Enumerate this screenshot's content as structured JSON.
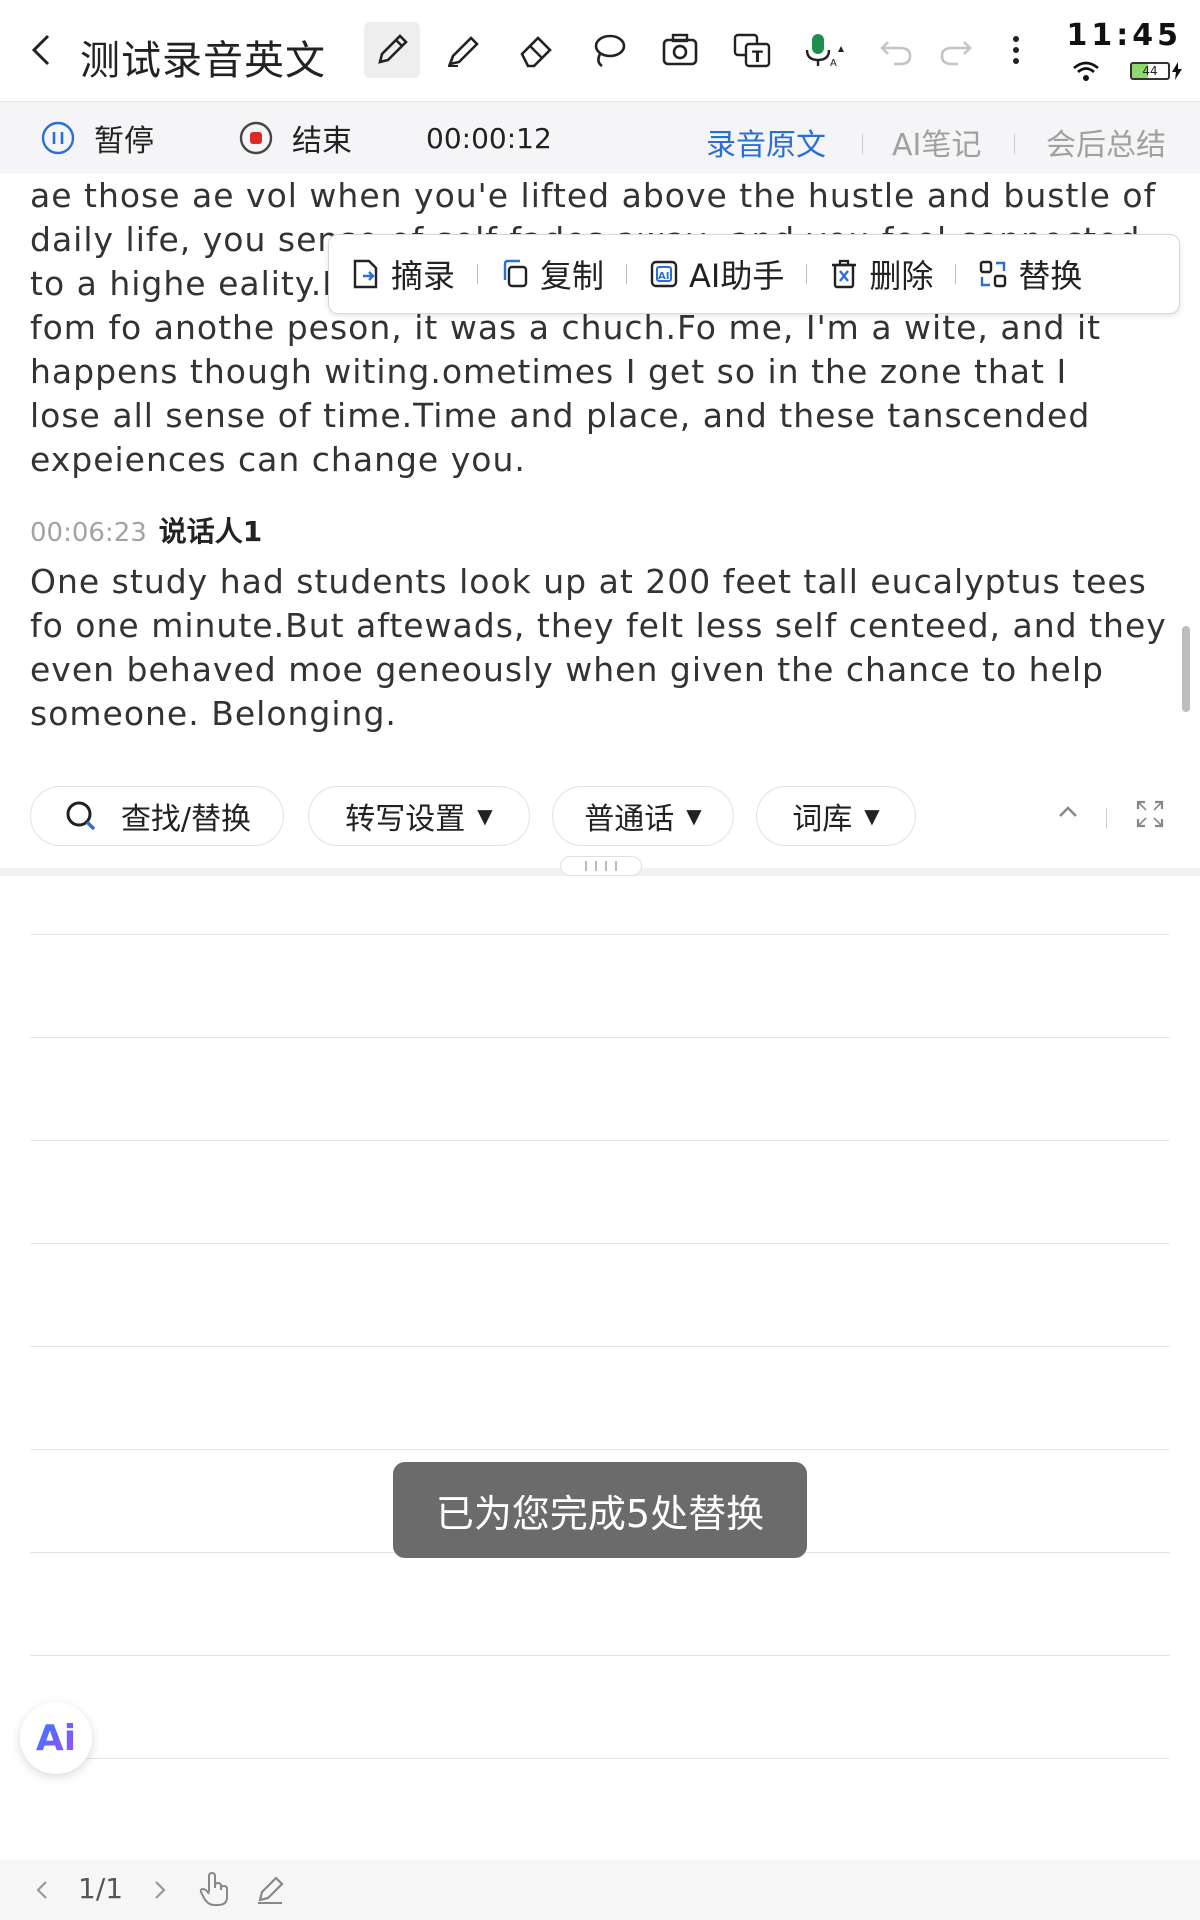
{
  "header": {
    "title": "测试录音英文",
    "tools": [
      "pen-tool",
      "highlighter-tool",
      "eraser-tool",
      "lasso-tool",
      "camera-tool",
      "translate-tool",
      "mic-tool",
      "undo",
      "redo",
      "more-menu"
    ]
  },
  "status_bar": {
    "time": "11:45",
    "battery": "44"
  },
  "recording": {
    "pause_label": "暂停",
    "end_label": "结束",
    "elapsed": "00:00:12",
    "tabs": [
      "录音原文",
      "AI笔记",
      "会后总结"
    ],
    "active_tab": "录音原文"
  },
  "transcript": {
    "para1_lines": [
      "ae those ae vol when you'e lifted above the hustle and bustle of",
      "daily life, you sense of self fades away, and you feel connected",
      "to a highe eality.For some, that happens though the songs, the",
      "fom fo anothe peson, it was a chuch.Fo me, I'm a wite, and it",
      "happens though witing.ometimes I get so in the zone that I",
      "lose all sense of time.Time and place, and these tanscended",
      "expeiences can change you."
    ],
    "entry2": {
      "timestamp": "00:06:23",
      "speaker": "说话人1",
      "lines": [
        "One study had students look up at 200 feet tall eucalyptus tees",
        "fo one minute.But aftewads, they felt less self centeed, and they",
        "even behaved moe geneously when given the chance to help",
        "someone. Belonging."
      ]
    }
  },
  "selection_popup": {
    "items": [
      "摘录",
      "复制",
      "AI助手",
      "删除",
      "替换"
    ]
  },
  "transcript_toolbar": {
    "find_replace": "查找/替换",
    "transcribe_settings": "转写设置",
    "language": "普通话",
    "lexicon": "词库"
  },
  "toast": "已为您完成5处替换",
  "ai_button": "Ai",
  "footer": {
    "page": "1/1"
  },
  "colors": {
    "accent": "#2b6fd6",
    "toast_bg": "#6b6b6b",
    "record_red": "#e02828"
  }
}
